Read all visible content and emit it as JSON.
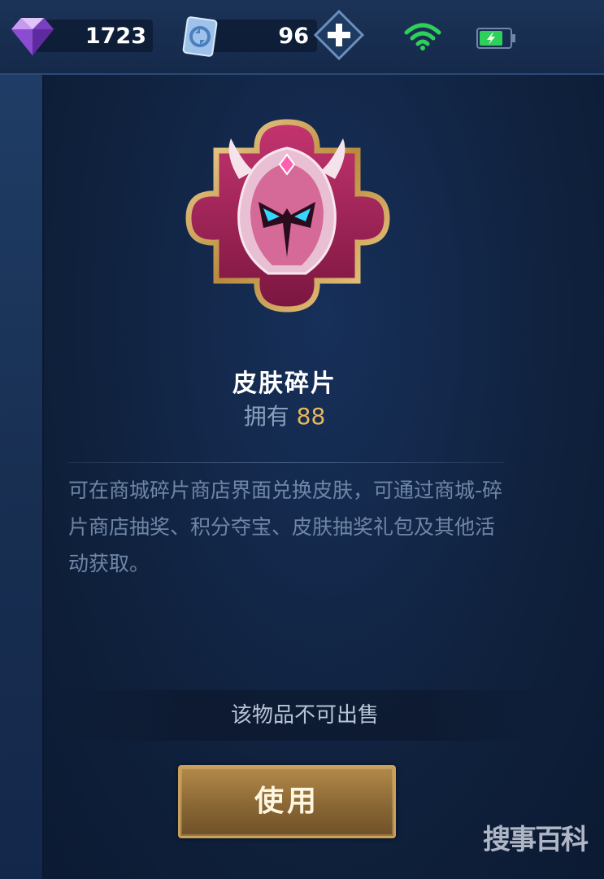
{
  "currency": {
    "gems": "1723",
    "coupons": "96"
  },
  "item": {
    "name": "皮肤碎片",
    "owned_label": "拥有",
    "owned_count": "88",
    "description": "可在商城碎片商店界面兑换皮肤，可通过商城-碎片商店抽奖、积分夺宝、皮肤抽奖礼包及其他活动获取。",
    "sell_notice": "该物品不可出售"
  },
  "actions": {
    "use_label": "使用"
  },
  "watermark": "搜事百科",
  "icons": {
    "gem": "purple-diamond-icon",
    "coupon": "point-coupon-icon",
    "add": "plus-icon",
    "wifi": "wifi-icon",
    "battery": "battery-charging-icon",
    "item": "skin-fragment-puzzle-icon"
  },
  "colors": {
    "accent_gold": "#e9b85a",
    "wifi_green": "#2ecf5a",
    "button_gold": "#c9a15a"
  }
}
